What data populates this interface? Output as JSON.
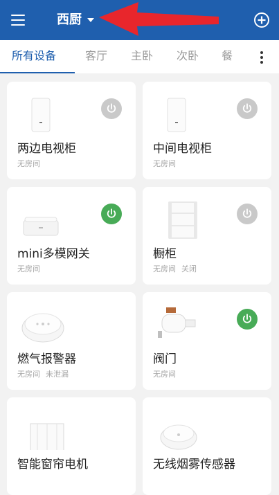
{
  "header": {
    "title": "西厨",
    "background": "#1f5fae",
    "arrow_color": "#e8262c"
  },
  "tabs": [
    {
      "label": "所有设备",
      "active": true
    },
    {
      "label": "客厅"
    },
    {
      "label": "主卧"
    },
    {
      "label": "次卧"
    },
    {
      "label": "餐"
    }
  ],
  "devices": [
    {
      "name": "两边电视柜",
      "room": "无房间",
      "status": "",
      "power": "off",
      "icon": "wall-panel-icon"
    },
    {
      "name": "中间电视柜",
      "room": "无房间",
      "status": "",
      "power": "off",
      "icon": "wall-panel-icon"
    },
    {
      "name": "mini多模网关",
      "room": "无房间",
      "status": "",
      "power": "on",
      "icon": "gateway-icon"
    },
    {
      "name": "橱柜",
      "room": "无房间",
      "status": "关闭",
      "power": "off",
      "icon": "curtain-switch-icon"
    },
    {
      "name": "燃气报警器",
      "room": "无房间",
      "status": "未泄漏",
      "power": null,
      "icon": "gas-detector-icon"
    },
    {
      "name": "阀门",
      "room": "无房间",
      "status": "",
      "power": "on",
      "icon": "valve-icon"
    },
    {
      "name": "智能窗帘电机",
      "room": "",
      "status": "",
      "power": null,
      "icon": "curtain-motor-icon"
    },
    {
      "name": "无线烟雾传感器",
      "room": "",
      "status": "",
      "power": null,
      "icon": "smoke-sensor-icon"
    }
  ],
  "colors": {
    "power_on": "#48ab57",
    "power_off": "#c9c9c9",
    "accent": "#1f5fae"
  }
}
